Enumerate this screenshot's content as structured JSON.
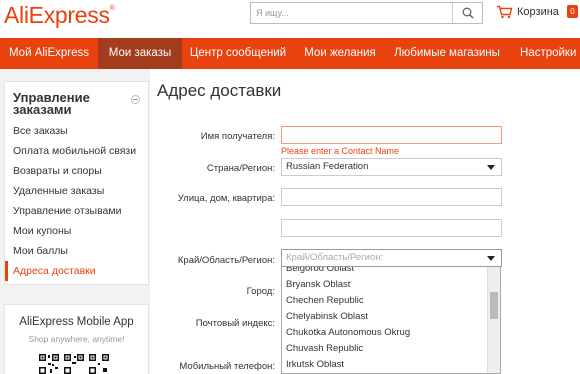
{
  "header": {
    "logo": "AliExpress",
    "logo_mark": "®",
    "search_placeholder": "Я ищу...",
    "search_icon": "search-icon",
    "cart_label": "Корзина",
    "cart_count": "0",
    "cart_icon": "cart-icon"
  },
  "nav": {
    "items": [
      {
        "label": "Мой AliExpress"
      },
      {
        "label": "Мои заказы",
        "active": true
      },
      {
        "label": "Центр сообщений"
      },
      {
        "label": "Мои желания"
      },
      {
        "label": "Любимые магазины"
      },
      {
        "label": "Настройки пр"
      }
    ]
  },
  "sidebar": {
    "title": "Управление заказами",
    "items": [
      {
        "label": "Все заказы"
      },
      {
        "label": "Оплата мобильной связи"
      },
      {
        "label": "Возвраты и споры"
      },
      {
        "label": "Удаленные заказы"
      },
      {
        "label": "Управление отзывами"
      },
      {
        "label": "Мои купоны"
      },
      {
        "label": "Мои баллы"
      },
      {
        "label": "Адреса доставки",
        "active": true
      }
    ]
  },
  "app_promo": {
    "title": "AliExpress Mobile App",
    "subtitle": "Shop anywhere, anytime!"
  },
  "form": {
    "page_title": "Адрес доставки",
    "recipient_label": "Имя получателя:",
    "recipient_value": "",
    "recipient_error": "Please enter a Contact Name",
    "country_label": "Страна/Регион:",
    "country_value": "Russian Federation",
    "street_label": "Улица, дом, квартира:",
    "street_value": "",
    "street2_value": "",
    "region_label": "Край/Область/Регион:",
    "region_placeholder": "Край/Область/Регион:",
    "city_label": "Город:",
    "zip_label": "Почтовый индекс:",
    "phone_label": "Мобильный телефон:"
  },
  "region_dropdown": {
    "options": [
      "Belgorod Oblast",
      "Bryansk Oblast",
      "Chechen Republic",
      "Chelyabinsk Oblast",
      "Chukotka Autonomous Okrug",
      "Chuvash Republic",
      "Irkutsk Oblast"
    ]
  },
  "colors": {
    "accent": "#e8420e",
    "nav_active": "#a23c1c",
    "error": "#e8420e"
  }
}
